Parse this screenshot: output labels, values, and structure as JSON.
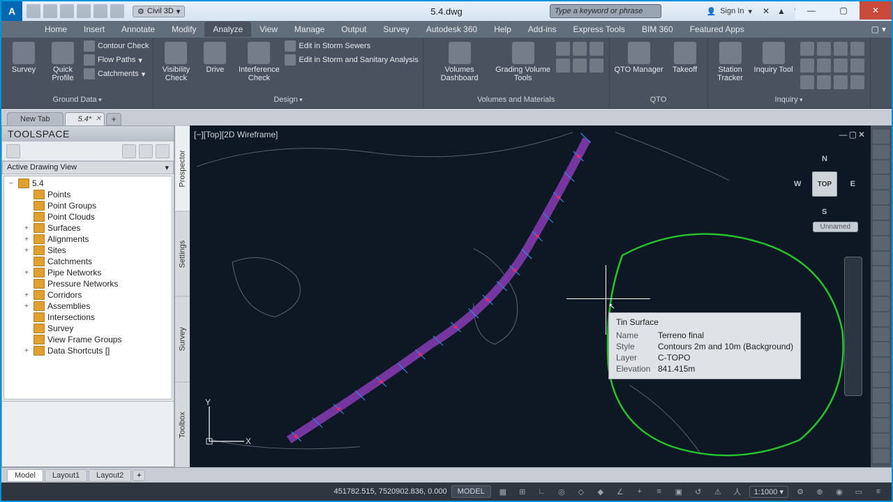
{
  "titlebar": {
    "workspace": "Civil 3D",
    "filename": "5.4.dwg",
    "search_placeholder": "Type a keyword or phrase",
    "signin": "Sign In"
  },
  "ribbon_tabs": [
    "Home",
    "Insert",
    "Annotate",
    "Modify",
    "Analyze",
    "View",
    "Manage",
    "Output",
    "Survey",
    "Autodesk 360",
    "Help",
    "Add-ins",
    "Express Tools",
    "BIM 360",
    "Featured Apps"
  ],
  "active_ribbon_tab": 4,
  "ribbon": {
    "ground": {
      "title": "Ground Data",
      "survey": "Survey",
      "quick_profile": "Quick\nProfile",
      "contour_check": "Contour Check",
      "flow_paths": "Flow Paths",
      "catchments": "Catchments"
    },
    "design": {
      "title": "Design",
      "visibility_check": "Visibility\nCheck",
      "drive": "Drive",
      "interference_check": "Interference\nCheck",
      "edit_storm": "Edit in Storm Sewers",
      "edit_storm_sanitary": "Edit in Storm and Sanitary Analysis"
    },
    "volumes": {
      "title": "Volumes and Materials",
      "volumes_dashboard": "Volumes Dashboard",
      "grading_volume": "Grading Volume\nTools"
    },
    "qto": {
      "title": "QTO",
      "qto_manager": "QTO Manager",
      "takeoff": "Takeoff"
    },
    "inquiry": {
      "title": "Inquiry",
      "station_tracker": "Station\nTracker",
      "inquiry_tool": "Inquiry Tool"
    }
  },
  "file_tabs": {
    "new_tab": "New Tab",
    "active": "5.4*"
  },
  "toolspace": {
    "title": "TOOLSPACE",
    "view": "Active Drawing View",
    "tree": [
      {
        "label": "5.4",
        "expand": "−",
        "root": true
      },
      {
        "label": "Points"
      },
      {
        "label": "Point Groups"
      },
      {
        "label": "Point Clouds"
      },
      {
        "label": "Surfaces",
        "expand": "+"
      },
      {
        "label": "Alignments",
        "expand": "+"
      },
      {
        "label": "Sites",
        "expand": "+"
      },
      {
        "label": "Catchments"
      },
      {
        "label": "Pipe Networks",
        "expand": "+"
      },
      {
        "label": "Pressure Networks"
      },
      {
        "label": "Corridors",
        "expand": "+"
      },
      {
        "label": "Assemblies",
        "expand": "+"
      },
      {
        "label": "Intersections"
      },
      {
        "label": "Survey"
      },
      {
        "label": "View Frame Groups"
      },
      {
        "label": "Data Shortcuts []",
        "expand": "+"
      }
    ],
    "side_tabs": [
      "Prospector",
      "Settings",
      "Survey",
      "Toolbox"
    ]
  },
  "viewport": {
    "label": "[−][Top][2D Wireframe]",
    "viewcube_face": "TOP",
    "viewcube_label": "Unnamed",
    "nsew": {
      "n": "N",
      "s": "S",
      "e": "E",
      "w": "W"
    },
    "ucs": {
      "x": "X",
      "y": "Y"
    }
  },
  "tooltip": {
    "title": "Tin Surface",
    "rows": [
      {
        "k": "Name",
        "v": "Terreno final"
      },
      {
        "k": "Style",
        "v": "Contours 2m and 10m (Background)"
      },
      {
        "k": "Layer",
        "v": "C-TOPO"
      },
      {
        "k": "Elevation",
        "v": "841.415m"
      }
    ]
  },
  "layout_tabs": [
    "Model",
    "Layout1",
    "Layout2"
  ],
  "statusbar": {
    "coords": "451782.515, 7520902.836, 0.000",
    "model": "MODEL",
    "scale": "1:1000"
  }
}
